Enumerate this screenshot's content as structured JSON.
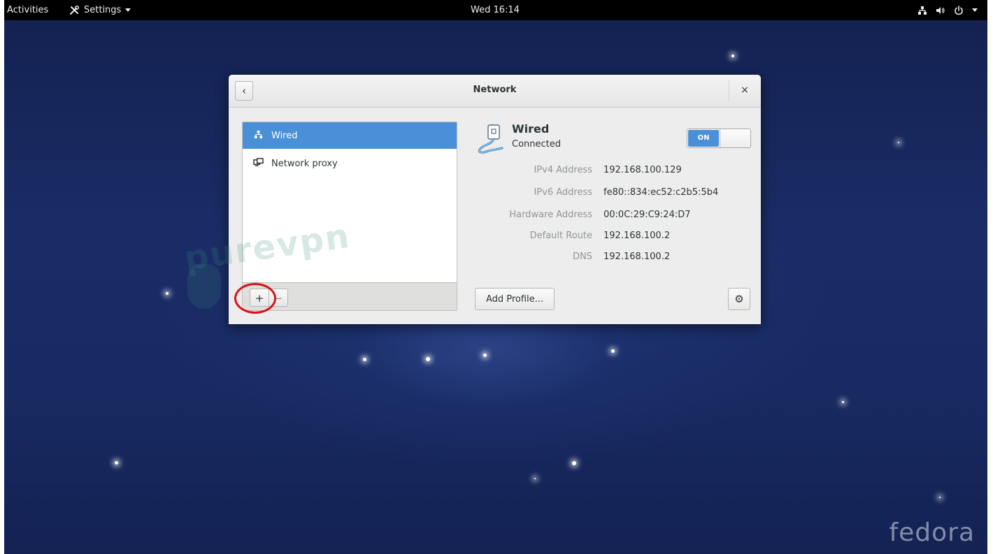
{
  "topbar": {
    "activities": "Activities",
    "app_name": "Settings",
    "clock": "Wed 16:14"
  },
  "window": {
    "title": "Network",
    "back_glyph": "‹",
    "close_glyph": "×"
  },
  "sidebar": {
    "items": [
      {
        "label": "Wired",
        "icon": "wired-network-icon",
        "selected": true
      },
      {
        "label": "Network proxy",
        "icon": "network-proxy-icon",
        "selected": false
      }
    ],
    "add_glyph": "+",
    "remove_glyph": "−"
  },
  "device": {
    "name": "Wired",
    "status": "Connected",
    "switch_label": "ON",
    "switch_on": true,
    "properties": [
      {
        "key": "IPv4 Address",
        "value": "192.168.100.129"
      },
      {
        "key": "IPv6 Address",
        "value": "fe80::834:ec52:c2b5:5b4"
      },
      {
        "key": "Hardware Address",
        "value": "00:0C:29:C9:24:D7"
      },
      {
        "key": "Default Route",
        "value": "192.168.100.2"
      },
      {
        "key": "DNS",
        "value": "192.168.100.2"
      }
    ],
    "add_profile_label": "Add Profile...",
    "gear_glyph": "⚙"
  },
  "overlay": {
    "watermark": "purevpn",
    "desktop_logo": "fedora",
    "highlight_color": "#d9111a"
  },
  "colors": {
    "accent": "#4a90d9",
    "topbar": "#000000"
  }
}
